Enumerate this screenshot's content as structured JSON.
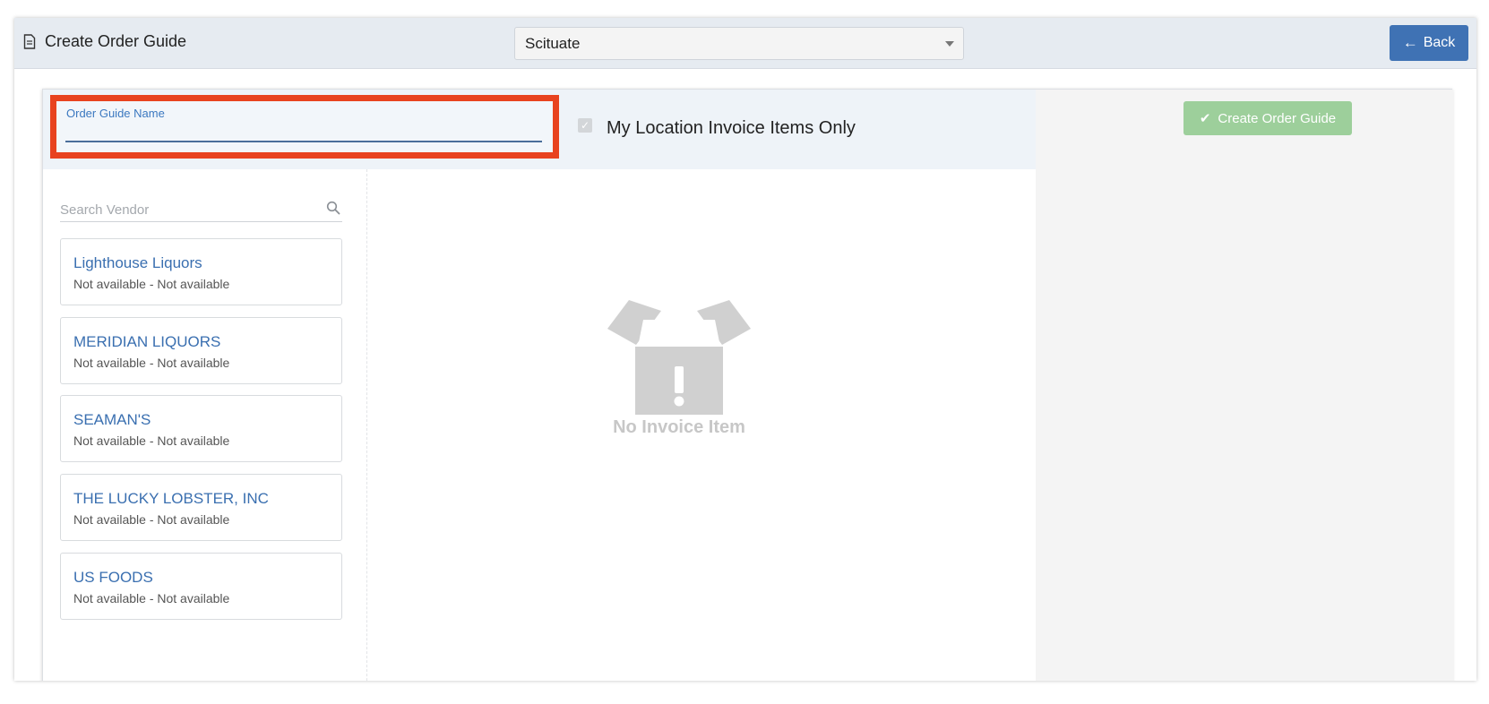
{
  "header": {
    "title": "Create Order Guide",
    "location_selected": "Scituate",
    "back_label": "Back"
  },
  "form": {
    "name_label": "Order Guide Name",
    "name_value": "",
    "location_only_label": "My Location Invoice Items Only",
    "location_only_checked": true,
    "create_label": "Create Order Guide"
  },
  "vendor_search": {
    "placeholder": "Search Vendor"
  },
  "vendors": [
    {
      "name": "Lighthouse Liquors",
      "detail": "Not available - Not available"
    },
    {
      "name": "MERIDIAN LIQUORS",
      "detail": "Not available - Not available"
    },
    {
      "name": "SEAMAN'S",
      "detail": "Not available - Not available"
    },
    {
      "name": "THE LUCKY LOBSTER, INC",
      "detail": "Not available - Not available"
    },
    {
      "name": "US FOODS",
      "detail": "Not available - Not available"
    }
  ],
  "empty_state": {
    "message": "No Invoice Item"
  },
  "colors": {
    "primary": "#3f72b4",
    "success_disabled": "#9dcf9b",
    "highlight": "#e8431f",
    "link": "#3a6fb0"
  }
}
